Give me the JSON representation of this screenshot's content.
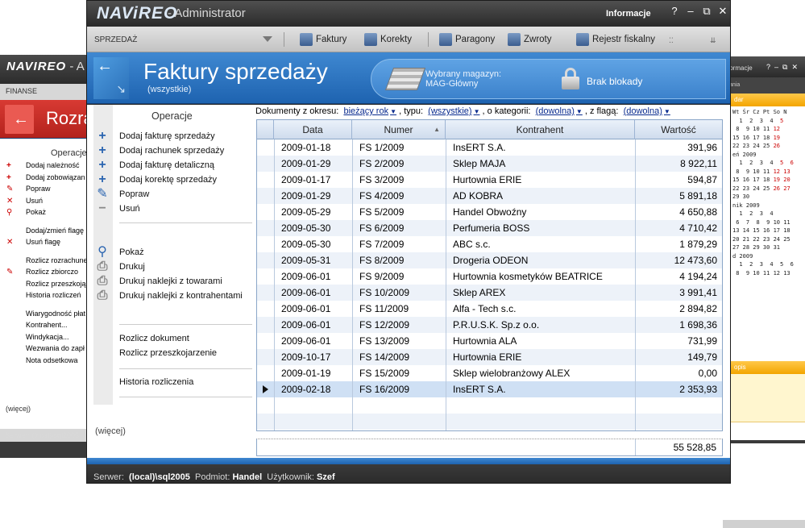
{
  "left_window": {
    "logo": "NAVIREO",
    "title_fragment": "- A",
    "menu": "FINANSE",
    "header_title": "Rozra",
    "ops_title": "Operacje",
    "items": [
      "Dodaj należność",
      "Dodaj zobowiązan",
      "Popraw",
      "Usuń",
      "Pokaż",
      "Dodaj/zmień flagę",
      "Usuń flagę",
      "Rozlicz rozrachune",
      "Rozlicz zbiorczo",
      "Rozlicz przeszkoją",
      "Historia rozliczeń",
      "Wiarygodność płat",
      "Kontrahent...",
      "Windykacja...",
      "Wezwania do zapł",
      "Nota odsetkowa"
    ],
    "more": "(więcej)",
    "status": "Serwer:  (local)\\sql2005"
  },
  "right_window": {
    "title": "formacje",
    "sub": "ania",
    "calendar_header": "dar",
    "calendar_dow": "Wt Śr Cz Pt So N",
    "months": [
      "eń 2009",
      "nik 2009",
      "d 2009"
    ],
    "notes_header": "opis"
  },
  "app": {
    "logo": "NAViREO",
    "title": "- Administrator",
    "info": "Informacje",
    "ctrl_help": "?",
    "ctrl_min": "‒",
    "ctrl_restore": "⧉",
    "ctrl_close": "✕"
  },
  "menubar": {
    "section": "SPRZEDAŻ",
    "items": [
      "Faktury",
      "Korekty",
      "Paragony",
      "Zwroty",
      "Rejestr fiskalny"
    ]
  },
  "header": {
    "title": "Faktury sprzedaży",
    "subtitle": "(wszystkie)",
    "warehouse_label": "Wybrany magazyn:",
    "warehouse_value": "MAG-Główny",
    "lock_status": "Brak blokady"
  },
  "operations": {
    "title": "Operacje",
    "group1": [
      "Dodaj fakturę sprzedaży",
      "Dodaj rachunek sprzedaży",
      "Dodaj fakturę detaliczną",
      "Dodaj korektę sprzedaży",
      "Popraw",
      "Usuń"
    ],
    "group2": [
      "Pokaż",
      "Drukuj",
      "Drukuj naklejki z towarami",
      "Drukuj naklejki z kontrahentami"
    ],
    "group3": [
      "Rozlicz dokument",
      "Rozlicz przeszkojarzenie"
    ],
    "group4": [
      "Historia rozliczenia"
    ],
    "more": "(więcej)"
  },
  "filters": {
    "period_label": "Dokumenty z okresu:",
    "period_value": "bieżący rok",
    "type_label": ", typu:",
    "type_value": "(wszystkie)",
    "category_label": ", o kategorii:",
    "category_value": "(dowolna)",
    "flag_label": ", z flagą:",
    "flag_value": "(dowolna)"
  },
  "table": {
    "columns": [
      "Data",
      "Numer",
      "Kontrahent",
      "Wartość"
    ],
    "rows": [
      [
        "2009-01-18",
        "FS 1/2009",
        "InsERT S.A.",
        "391,96"
      ],
      [
        "2009-01-29",
        "FS 2/2009",
        "Sklep MAJA",
        "8 922,11"
      ],
      [
        "2009-01-17",
        "FS 3/2009",
        "Hurtownia ERIE",
        "594,87"
      ],
      [
        "2009-01-29",
        "FS 4/2009",
        "AD KOBRA",
        "5 891,18"
      ],
      [
        "2009-05-29",
        "FS 5/2009",
        "Handel Obwoźny",
        "4 650,88"
      ],
      [
        "2009-05-30",
        "FS 6/2009",
        "Perfumeria BOSS",
        "4 710,42"
      ],
      [
        "2009-05-30",
        "FS 7/2009",
        "ABC s.c.",
        "1 879,29"
      ],
      [
        "2009-05-31",
        "FS 8/2009",
        "Drogeria ODEON",
        "12 473,60"
      ],
      [
        "2009-06-01",
        "FS 9/2009",
        "Hurtownia kosmetyków BEATRICE",
        "4 194,24"
      ],
      [
        "2009-06-01",
        "FS 10/2009",
        "Sklep AREX",
        "3 991,41"
      ],
      [
        "2009-06-01",
        "FS 11/2009",
        "Alfa - Tech s.c.",
        "2 894,82"
      ],
      [
        "2009-06-01",
        "FS 12/2009",
        "P.R.U.S.K. Sp.z o.o.",
        "1 698,36"
      ],
      [
        "2009-06-01",
        "FS 13/2009",
        "Hurtownia ALA",
        "731,99"
      ],
      [
        "2009-10-17",
        "FS 14/2009",
        "Hurtownia ERIE",
        "149,79"
      ],
      [
        "2009-01-19",
        "FS 15/2009",
        "Sklep wielobranżowy  ALEX",
        "0,00"
      ],
      [
        "2009-02-18",
        "FS 16/2009",
        "InsERT S.A.",
        "2 353,93"
      ]
    ],
    "selected_row": 15,
    "total": "55 528,85"
  },
  "status": {
    "server_label": "Serwer:",
    "server": "(local)\\sql2005",
    "entity_label": "Podmiot:",
    "entity": "Handel",
    "user_label": "Użytkownik:",
    "user": "Szef"
  },
  "colors": {
    "header_blue": "#2a72c0",
    "left_header_red": "#c62b24",
    "right_accent_orange": "#f3a500"
  }
}
